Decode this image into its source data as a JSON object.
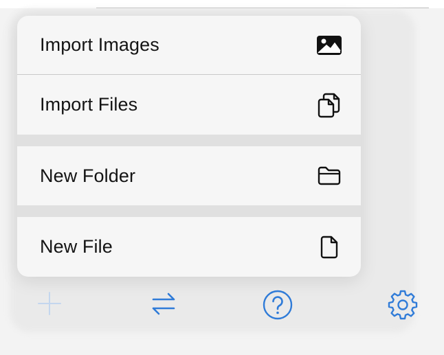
{
  "menu": {
    "items": [
      {
        "label": "Import Images",
        "icon": "photo-icon"
      },
      {
        "label": "Import Files",
        "icon": "documents-icon"
      },
      {
        "label": "New Folder",
        "icon": "folder-icon"
      },
      {
        "label": "New File",
        "icon": "document-icon"
      }
    ]
  },
  "toolbar": {
    "buttons": [
      {
        "icon": "plus-icon",
        "state": "disabled"
      },
      {
        "icon": "swap-arrows-icon"
      },
      {
        "icon": "question-circle-icon"
      },
      {
        "icon": "gear-icon"
      }
    ]
  },
  "colors": {
    "accent": "#2f7bd8",
    "disabled": "#c3d6ee",
    "text": "#141414",
    "menu_bg": "#f6f6f6",
    "separator": "#e0e0e0"
  }
}
